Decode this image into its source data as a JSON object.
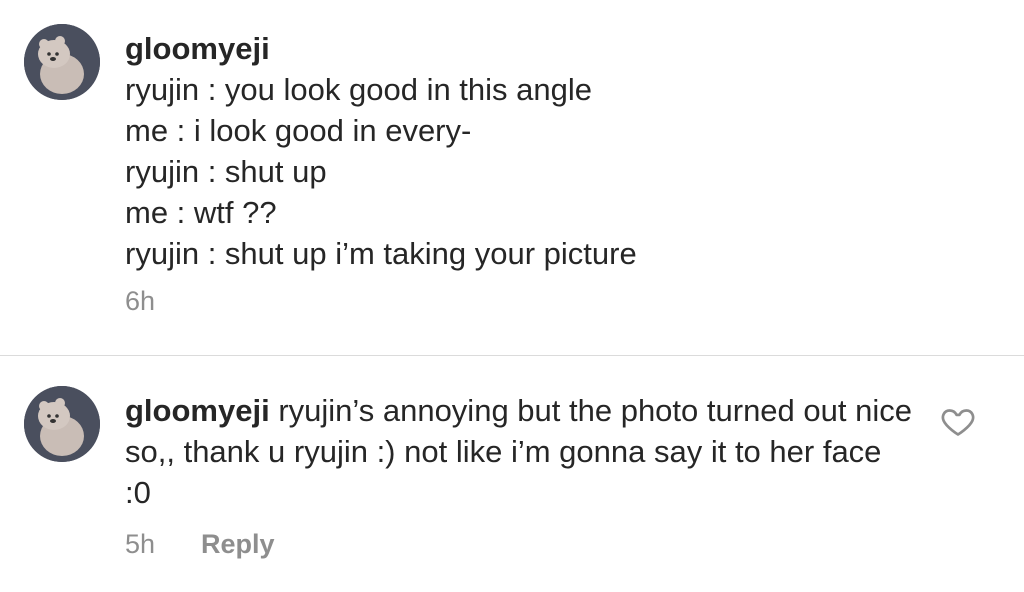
{
  "comments": [
    {
      "username": "gloomyeji",
      "lines": [
        "ryujin : you look good in this angle",
        "me : i look good in every-",
        "ryujin : shut up",
        "me : wtf ??",
        "ryujin : shut up i’m taking your picture"
      ],
      "time": "6h"
    },
    {
      "username": "gloomyeji",
      "text": "ryujin’s annoying but the photo turned out nice so,, thank u ryujin :) not like i’m gonna say it to her face :0",
      "time": "5h",
      "reply_label": "Reply",
      "like_icon": "heart-outline-icon"
    }
  ],
  "colors": {
    "text": "#262626",
    "meta": "#8e8e8e",
    "divider": "#dbdbdb",
    "avatar_bg": "#4a4f5e",
    "bear": "#c9bdb6"
  }
}
